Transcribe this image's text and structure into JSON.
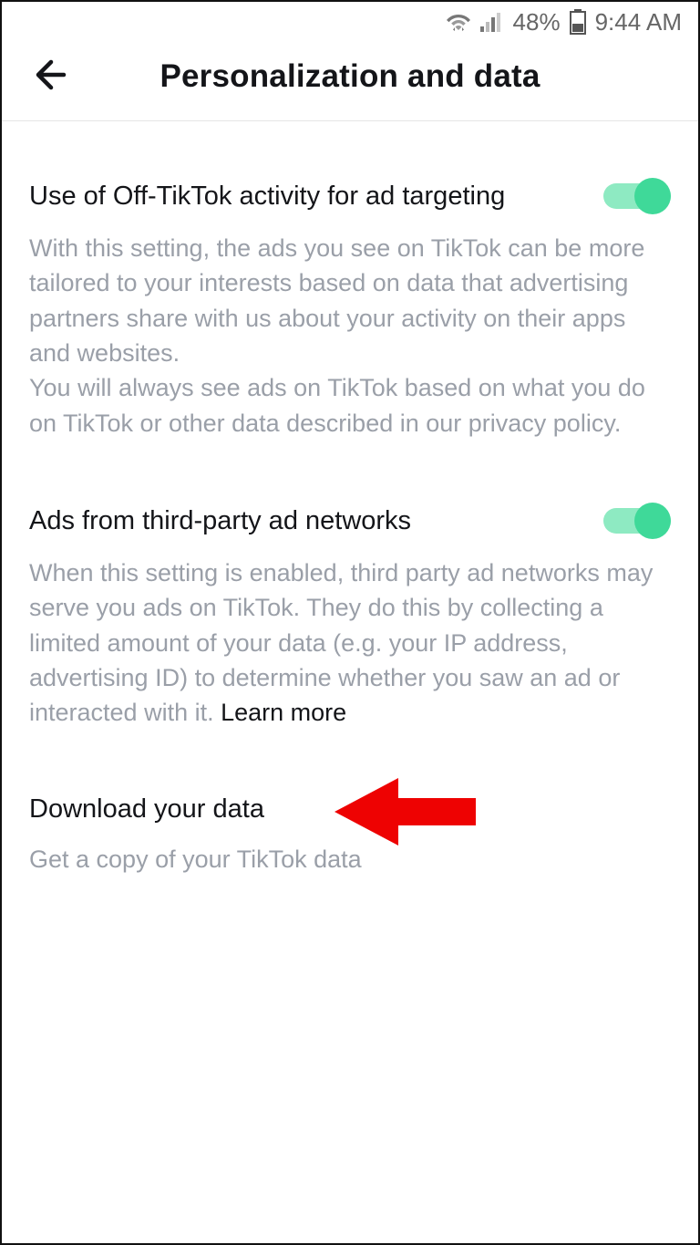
{
  "status": {
    "battery_pct": "48%",
    "time": "9:44 AM"
  },
  "header": {
    "title": "Personalization and data"
  },
  "settings": [
    {
      "title": "Use of Off-TikTok activity for ad targeting",
      "desc_1": "With this setting, the ads you see on TikTok can be more tailored to your interests based on data that advertising partners share with us about your activity on their apps and websites.",
      "desc_2": "You will always see ads on TikTok based on what you do on TikTok or other data described in our privacy policy.",
      "toggle_on": true
    },
    {
      "title": "Ads from third-party ad networks",
      "desc_1": "When this setting is enabled, third party ad networks may serve you ads on TikTok. They do this by collecting a limited amount of your data (e.g. your IP address, advertising ID) to determine whether you saw an ad or interacted with it. ",
      "learn_more": "Learn more",
      "toggle_on": true
    },
    {
      "title": "Download your data",
      "desc_1": "Get a copy of your TikTok data"
    }
  ]
}
